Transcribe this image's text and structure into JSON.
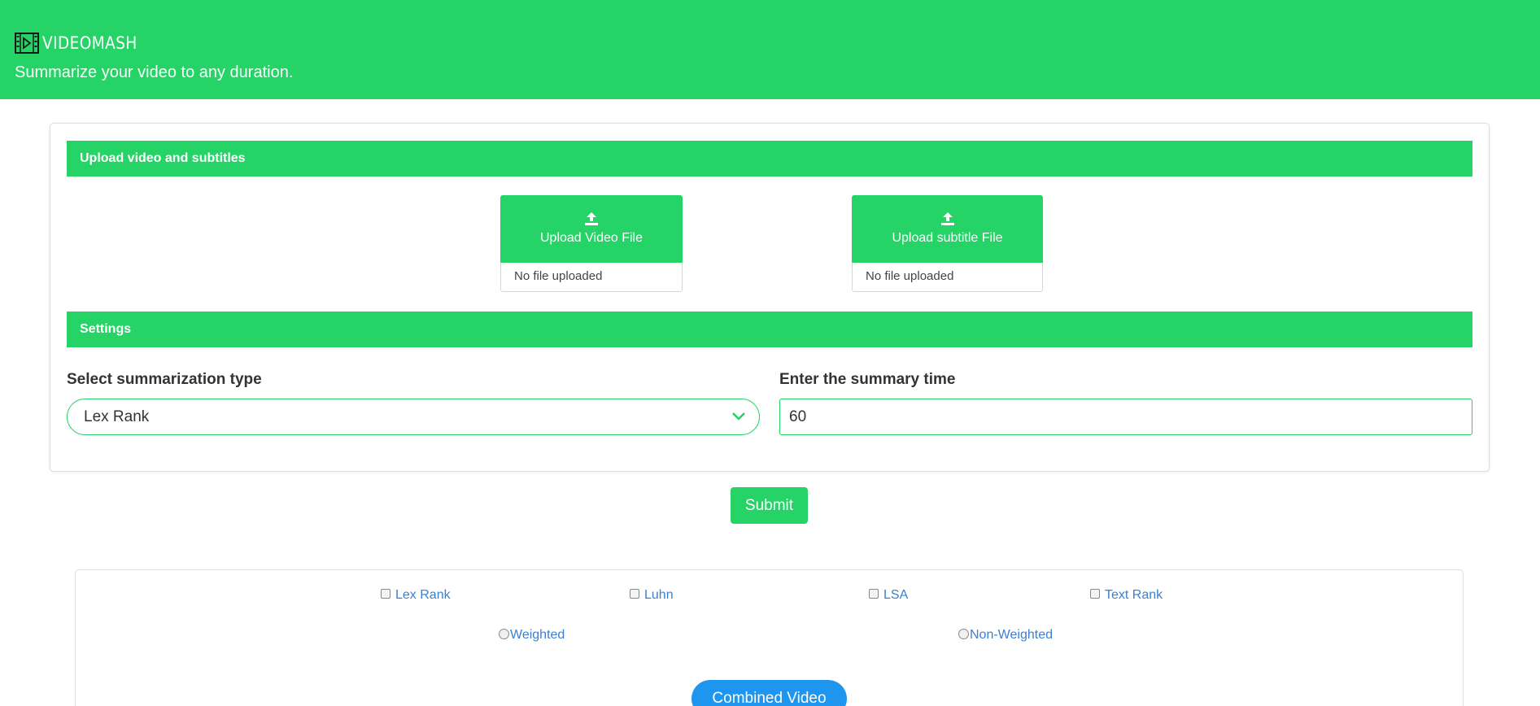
{
  "header": {
    "brand": "VIDEOMASH",
    "tagline": "Summarize your video to any duration."
  },
  "upload_section": {
    "title": "Upload video and subtitles",
    "video_button": "Upload Video File",
    "video_status": "No file uploaded",
    "subtitle_button": "Upload subtitle File",
    "subtitle_status": "No file uploaded"
  },
  "settings_section": {
    "title": "Settings",
    "type_label": "Select summarization type",
    "type_selected": "Lex Rank",
    "time_label": "Enter the summary time",
    "time_value": "60"
  },
  "submit_label": "Submit",
  "results": {
    "checkboxes": [
      {
        "label": "Lex Rank",
        "checked": false
      },
      {
        "label": "Luhn",
        "checked": false
      },
      {
        "label": "LSA",
        "checked": false
      },
      {
        "label": "Text Rank",
        "checked": false
      }
    ],
    "radios": [
      {
        "label": "Weighted",
        "selected": false
      },
      {
        "label": "Non-Weighted",
        "selected": false
      }
    ],
    "combined_button": "Combined Video"
  },
  "colors": {
    "brand_green": "#25d366",
    "link_blue": "#3b7fd0",
    "button_blue": "#1e96f0"
  },
  "icons": {
    "logo": "film-play-icon",
    "upload": "upload-icon",
    "dropdown": "chevron-down-icon"
  }
}
